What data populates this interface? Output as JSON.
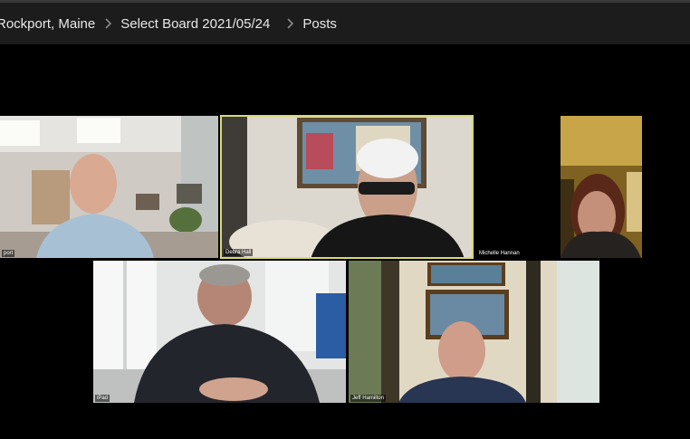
{
  "breadcrumb": {
    "items": [
      "Rockport, Maine",
      "Select Board 2021/05/24",
      "Posts"
    ],
    "separator_icon": "chevron-right-icon"
  },
  "meeting": {
    "participants": [
      {
        "name": "port"
      },
      {
        "name": "Debra Hall",
        "active_speaker": true
      },
      {
        "name": "Michelle Hannan"
      },
      {
        "name": "iPad"
      },
      {
        "name": "Jeff Hamilton"
      }
    ]
  },
  "colors": {
    "background": "#000000",
    "breadcrumb_bar": "#1c1c1c",
    "active_speaker_border": "#d8d87a"
  }
}
